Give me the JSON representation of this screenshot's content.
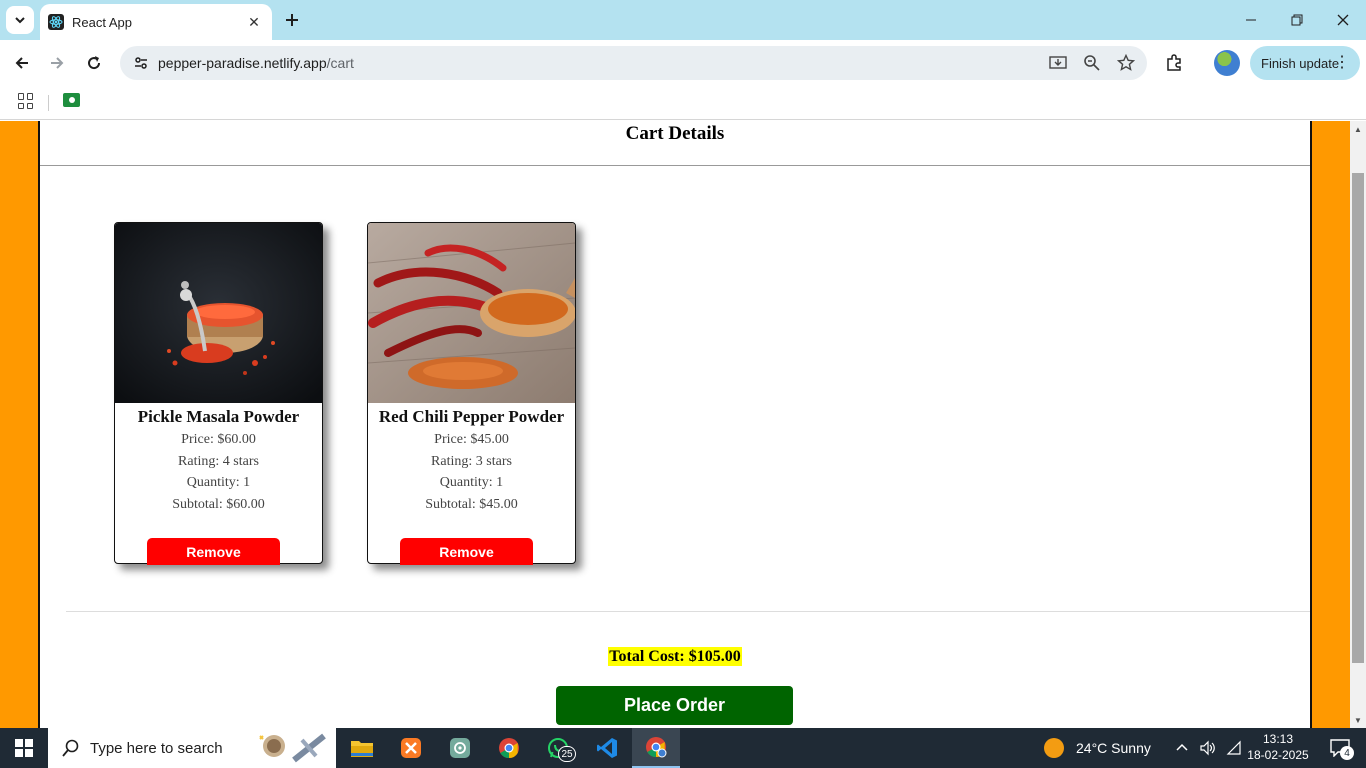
{
  "browser": {
    "tab_title": "React App",
    "url_host": "pepper-paradise.netlify.app",
    "url_path": "/cart",
    "finish_update_label": "Finish update"
  },
  "page": {
    "heading": "Cart Details",
    "items": [
      {
        "name": "Pickle Masala Powder",
        "price": "Price: $60.00",
        "rating": "Rating: 4 stars",
        "quantity": "Quantity: 1",
        "subtotal": "Subtotal: $60.00",
        "remove_label": "Remove"
      },
      {
        "name": "Red Chili Pepper Powder",
        "price": "Price: $45.00",
        "rating": "Rating: 3 stars",
        "quantity": "Quantity: 1",
        "subtotal": "Subtotal: $45.00",
        "remove_label": "Remove"
      }
    ],
    "total": "Total Cost: $105.00",
    "place_order_label": "Place Order"
  },
  "taskbar": {
    "search_placeholder": "Type here to search",
    "whatsapp_badge": "25",
    "weather": "24°C  Sunny",
    "time": "13:13",
    "date": "18-02-2025",
    "notification_count": "4"
  },
  "colors": {
    "page_background": "#ff9900",
    "remove_button": "#ff0000",
    "place_order_button": "#006400",
    "total_highlight": "#ffff00",
    "tab_strip": "#b4e2f0"
  }
}
